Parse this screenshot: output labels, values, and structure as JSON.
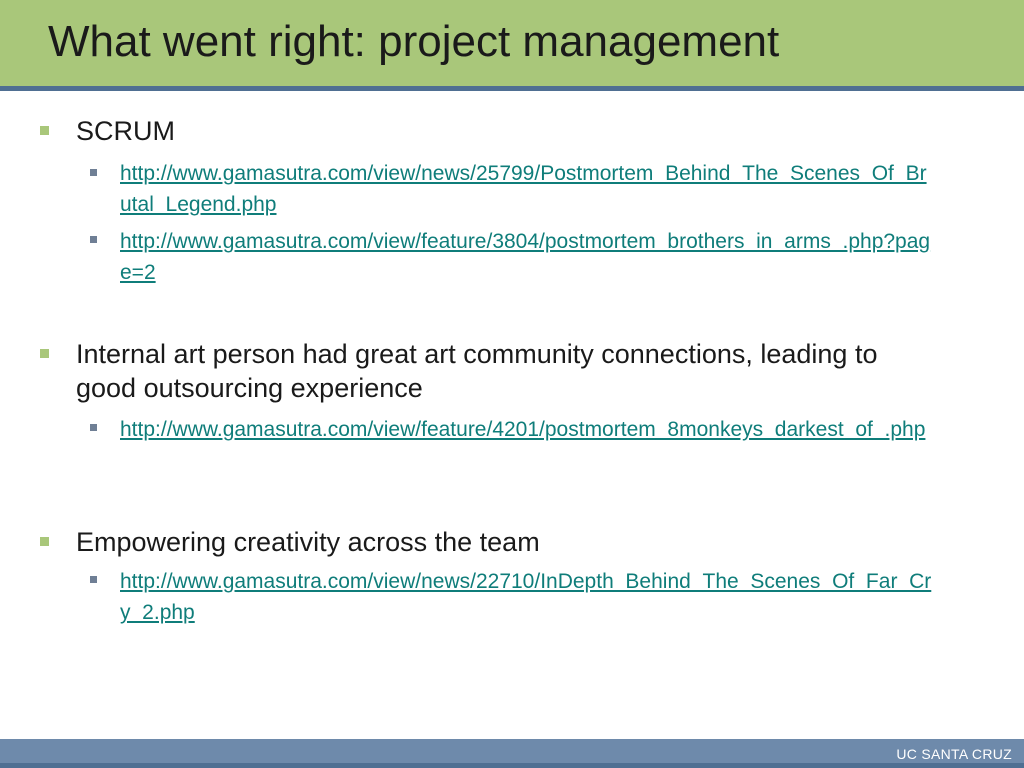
{
  "slide": {
    "title": "What went right: project management"
  },
  "bullets": [
    {
      "text": "SCRUM",
      "links": [
        "http://www.gamasutra.com/view/news/25799/Postmortem_Behind_The_Scenes_Of_Brutal_Legend.php",
        "http://www.gamasutra.com/view/feature/3804/postmortem_brothers_in_arms_.php?page=2"
      ]
    },
    {
      "text": "Internal art person had great art community connections, leading to good outsourcing experience",
      "links": [
        "http://www.gamasutra.com/view/feature/4201/postmortem_8monkeys_darkest_of_.php"
      ]
    },
    {
      "text": "Empowering creativity across the team",
      "links": [
        "http://www.gamasutra.com/view/news/22710/InDepth_Behind_The_Scenes_Of_Far_Cry_2.php"
      ]
    }
  ],
  "footer": {
    "text": "UC SANTA CRUZ"
  },
  "colors": {
    "title_band": "#a9c77a",
    "accent_rule": "#4f6f92",
    "link": "#0f7d7a",
    "footer_band": "#6e8aab"
  }
}
